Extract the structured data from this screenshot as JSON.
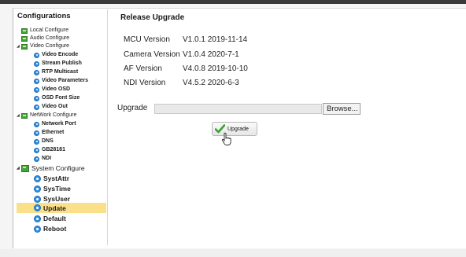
{
  "sidebar": {
    "title": "Configurations",
    "items": [
      {
        "label": "Local Configure"
      },
      {
        "label": "Audio Configure"
      },
      {
        "label": "Video Configure"
      },
      {
        "label": "Video Encode"
      },
      {
        "label": "Stream Publish"
      },
      {
        "label": "RTP Multicast"
      },
      {
        "label": "Video Parameters"
      },
      {
        "label": "Video OSD"
      },
      {
        "label": "OSD Font Size"
      },
      {
        "label": "Video Out"
      },
      {
        "label": "NetWork Configure"
      },
      {
        "label": "Network Port"
      },
      {
        "label": "Ethernet"
      },
      {
        "label": "DNS"
      },
      {
        "label": "GB28181"
      },
      {
        "label": "NDI"
      },
      {
        "label": "System Configure"
      },
      {
        "label": "SystAttr"
      },
      {
        "label": "SysTime"
      },
      {
        "label": "SysUser"
      },
      {
        "label": "Update",
        "selected": true
      },
      {
        "label": "Default"
      },
      {
        "label": "Reboot"
      }
    ]
  },
  "main": {
    "title": "Release Upgrade",
    "versions": [
      {
        "label": "MCU Version",
        "value": "V1.0.1  2019-11-14"
      },
      {
        "label": "Camera Version",
        "value": "V1.0.4  2020-7-1"
      },
      {
        "label": "AF Version",
        "value": "V4.0.8  2019-10-10"
      },
      {
        "label": "NDI Version",
        "value": "V4.5.2  2020-6-3"
      }
    ],
    "upgrade_label": "Upgrade",
    "file_value": "",
    "browse_label": "Browse...",
    "upgrade_button_label": "Upgrade"
  },
  "colors": {
    "selection": "#fbe08a",
    "folder_icon": "#46a33a",
    "circle_icon": "#2f8fe0"
  }
}
